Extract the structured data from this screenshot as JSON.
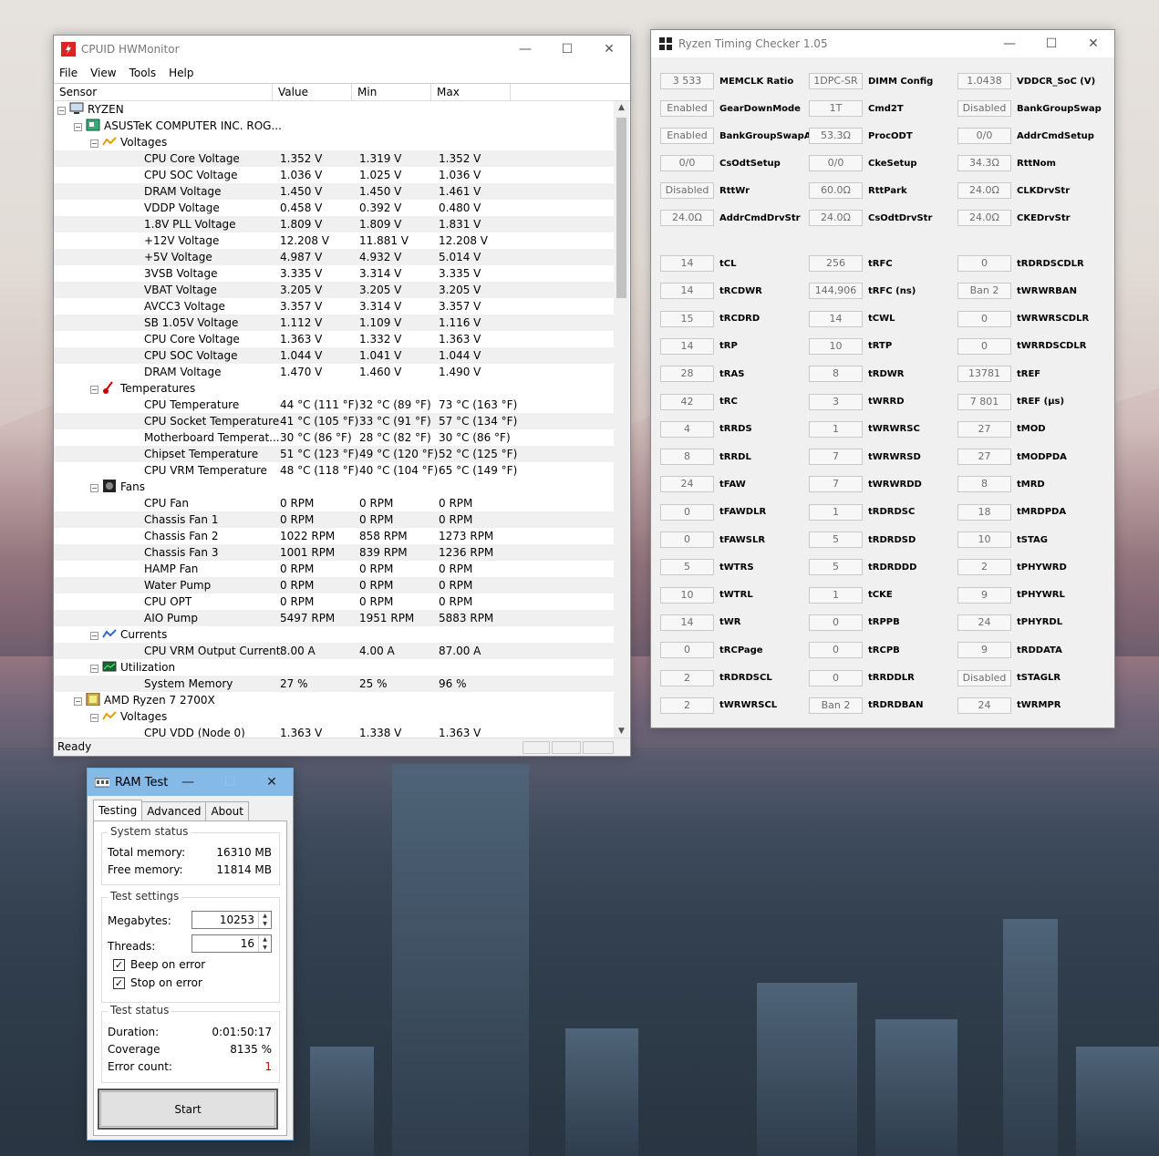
{
  "hwmonitor": {
    "title": "CPUID HWMonitor",
    "menu": [
      "File",
      "View",
      "Tools",
      "Help"
    ],
    "columns": [
      "Sensor",
      "Value",
      "Min",
      "Max"
    ],
    "status": "Ready",
    "rows": [
      {
        "level": 0,
        "type": "node",
        "icon": "computer-icon",
        "name": "RYZEN"
      },
      {
        "level": 1,
        "type": "node",
        "icon": "motherboard-icon",
        "name": "ASUSTeK COMPUTER INC. ROG..."
      },
      {
        "level": 2,
        "type": "node",
        "icon": "voltage-icon",
        "name": "Voltages"
      },
      {
        "level": 3,
        "name": "CPU Core Voltage",
        "value": "1.352 V",
        "min": "1.319 V",
        "max": "1.352 V"
      },
      {
        "level": 3,
        "name": "CPU SOC Voltage",
        "value": "1.036 V",
        "min": "1.025 V",
        "max": "1.036 V"
      },
      {
        "level": 3,
        "name": "DRAM Voltage",
        "value": "1.450 V",
        "min": "1.450 V",
        "max": "1.461 V"
      },
      {
        "level": 3,
        "name": "VDDP Voltage",
        "value": "0.458 V",
        "min": "0.392 V",
        "max": "0.480 V"
      },
      {
        "level": 3,
        "name": "1.8V PLL Voltage",
        "value": "1.809 V",
        "min": "1.809 V",
        "max": "1.831 V"
      },
      {
        "level": 3,
        "name": "+12V Voltage",
        "value": "12.208 V",
        "min": "11.881 V",
        "max": "12.208 V"
      },
      {
        "level": 3,
        "name": "+5V Voltage",
        "value": "4.987 V",
        "min": "4.932 V",
        "max": "5.014 V"
      },
      {
        "level": 3,
        "name": "3VSB Voltage",
        "value": "3.335 V",
        "min": "3.314 V",
        "max": "3.335 V"
      },
      {
        "level": 3,
        "name": "VBAT Voltage",
        "value": "3.205 V",
        "min": "3.205 V",
        "max": "3.205 V"
      },
      {
        "level": 3,
        "name": "AVCC3 Voltage",
        "value": "3.357 V",
        "min": "3.314 V",
        "max": "3.357 V"
      },
      {
        "level": 3,
        "name": "SB 1.05V Voltage",
        "value": "1.112 V",
        "min": "1.109 V",
        "max": "1.116 V"
      },
      {
        "level": 3,
        "name": "CPU Core Voltage",
        "value": "1.363 V",
        "min": "1.332 V",
        "max": "1.363 V"
      },
      {
        "level": 3,
        "name": "CPU SOC Voltage",
        "value": "1.044 V",
        "min": "1.041 V",
        "max": "1.044 V"
      },
      {
        "level": 3,
        "name": "DRAM Voltage",
        "value": "1.470 V",
        "min": "1.460 V",
        "max": "1.490 V"
      },
      {
        "level": 2,
        "type": "node",
        "icon": "thermometer-icon",
        "name": "Temperatures"
      },
      {
        "level": 3,
        "name": "CPU Temperature",
        "value": "44 °C  (111 °F)",
        "min": "32 °C  (89 °F)",
        "max": "73 °C  (163 °F)"
      },
      {
        "level": 3,
        "name": "CPU Socket Temperature",
        "value": "41 °C  (105 °F)",
        "min": "33 °C  (91 °F)",
        "max": "57 °C  (134 °F)"
      },
      {
        "level": 3,
        "name": "Motherboard Temperat...",
        "value": "30 °C  (86 °F)",
        "min": "28 °C  (82 °F)",
        "max": "30 °C  (86 °F)"
      },
      {
        "level": 3,
        "name": "Chipset Temperature",
        "value": "51 °C  (123 °F)",
        "min": "49 °C  (120 °F)",
        "max": "52 °C  (125 °F)"
      },
      {
        "level": 3,
        "name": "CPU VRM Temperature",
        "value": "48 °C  (118 °F)",
        "min": "40 °C  (104 °F)",
        "max": "65 °C  (149 °F)"
      },
      {
        "level": 2,
        "type": "node",
        "icon": "fan-icon",
        "name": "Fans"
      },
      {
        "level": 3,
        "name": "CPU Fan",
        "value": "0 RPM",
        "min": "0 RPM",
        "max": "0 RPM"
      },
      {
        "level": 3,
        "name": "Chassis Fan 1",
        "value": "0 RPM",
        "min": "0 RPM",
        "max": "0 RPM"
      },
      {
        "level": 3,
        "name": "Chassis Fan 2",
        "value": "1022 RPM",
        "min": "858 RPM",
        "max": "1273 RPM"
      },
      {
        "level": 3,
        "name": "Chassis Fan 3",
        "value": "1001 RPM",
        "min": "839 RPM",
        "max": "1236 RPM"
      },
      {
        "level": 3,
        "name": "HAMP Fan",
        "value": "0 RPM",
        "min": "0 RPM",
        "max": "0 RPM"
      },
      {
        "level": 3,
        "name": "Water Pump",
        "value": "0 RPM",
        "min": "0 RPM",
        "max": "0 RPM"
      },
      {
        "level": 3,
        "name": "CPU OPT",
        "value": "0 RPM",
        "min": "0 RPM",
        "max": "0 RPM"
      },
      {
        "level": 3,
        "name": "AIO Pump",
        "value": "5497 RPM",
        "min": "1951 RPM",
        "max": "5883 RPM"
      },
      {
        "level": 2,
        "type": "node",
        "icon": "current-icon",
        "name": "Currents"
      },
      {
        "level": 3,
        "name": "CPU VRM Output Current",
        "value": "8.00 A",
        "min": "4.00 A",
        "max": "87.00 A"
      },
      {
        "level": 2,
        "type": "node",
        "icon": "utilization-icon",
        "name": "Utilization"
      },
      {
        "level": 3,
        "name": "System Memory",
        "value": "27 %",
        "min": "25 %",
        "max": "96 %"
      },
      {
        "level": 1,
        "type": "node",
        "icon": "cpu-chip-icon",
        "name": "AMD Ryzen 7 2700X"
      },
      {
        "level": 2,
        "type": "node",
        "icon": "voltage-icon",
        "name": "Voltages"
      },
      {
        "level": 3,
        "name": "CPU VDD (Node 0)",
        "value": "1.363 V",
        "min": "1.338 V",
        "max": "1.363 V"
      }
    ]
  },
  "rtc": {
    "title": "Ryzen Timing Checker 1.05",
    "top_items": [
      {
        "value": "3 533",
        "label": "MEMCLK Ratio"
      },
      {
        "value": "1DPC-SR",
        "label": "DIMM Config"
      },
      {
        "value": "1.0438",
        "label": "VDDCR_SoC (V)"
      },
      {
        "value": "Enabled",
        "label": "GearDownMode"
      },
      {
        "value": "1T",
        "label": "Cmd2T"
      },
      {
        "value": "Disabled",
        "label": "BankGroupSwap"
      },
      {
        "value": "Enabled",
        "label": "BankGroupSwapAlt"
      },
      {
        "value": "53.3Ω",
        "label": "ProcODT"
      },
      {
        "value": "0/0",
        "label": "AddrCmdSetup"
      },
      {
        "value": "0/0",
        "label": "CsOdtSetup"
      },
      {
        "value": "0/0",
        "label": "CkeSetup"
      },
      {
        "value": "34.3Ω",
        "label": "RttNom"
      },
      {
        "value": "Disabled",
        "label": "RttWr"
      },
      {
        "value": "60.0Ω",
        "label": "RttPark"
      },
      {
        "value": "24.0Ω",
        "label": "CLKDrvStr"
      },
      {
        "value": "24.0Ω",
        "label": "AddrCmdDrvStr"
      },
      {
        "value": "24.0Ω",
        "label": "CsOdtDrvStr"
      },
      {
        "value": "24.0Ω",
        "label": "CKEDrvStr"
      }
    ],
    "timing_items": [
      {
        "value": "14",
        "label": "tCL"
      },
      {
        "value": "256",
        "label": "tRFC"
      },
      {
        "value": "0",
        "label": "tRDRDSCDLR"
      },
      {
        "value": "14",
        "label": "tRCDWR"
      },
      {
        "value": "144,906",
        "label": "tRFC (ns)"
      },
      {
        "value": "Ban 2",
        "label": "tWRWRBAN"
      },
      {
        "value": "15",
        "label": "tRCDRD"
      },
      {
        "value": "14",
        "label": "tCWL"
      },
      {
        "value": "0",
        "label": "tWRWRSCDLR"
      },
      {
        "value": "14",
        "label": "tRP"
      },
      {
        "value": "10",
        "label": "tRTP"
      },
      {
        "value": "0",
        "label": "tWRRDSCDLR"
      },
      {
        "value": "28",
        "label": "tRAS"
      },
      {
        "value": "8",
        "label": "tRDWR"
      },
      {
        "value": "13781",
        "label": "tREF"
      },
      {
        "value": "42",
        "label": "tRC"
      },
      {
        "value": "3",
        "label": "tWRRD"
      },
      {
        "value": "7 801",
        "label": "tREF (µs)"
      },
      {
        "value": "4",
        "label": "tRRDS"
      },
      {
        "value": "1",
        "label": "tWRWRSC"
      },
      {
        "value": "27",
        "label": "tMOD"
      },
      {
        "value": "8",
        "label": "tRRDL"
      },
      {
        "value": "7",
        "label": "tWRWRSD"
      },
      {
        "value": "27",
        "label": "tMODPDA"
      },
      {
        "value": "24",
        "label": "tFAW"
      },
      {
        "value": "7",
        "label": "tWRWRDD"
      },
      {
        "value": "8",
        "label": "tMRD"
      },
      {
        "value": "0",
        "label": "tFAWDLR"
      },
      {
        "value": "1",
        "label": "tRDRDSC"
      },
      {
        "value": "18",
        "label": "tMRDPDA"
      },
      {
        "value": "0",
        "label": "tFAWSLR"
      },
      {
        "value": "5",
        "label": "tRDRDSD"
      },
      {
        "value": "10",
        "label": "tSTAG"
      },
      {
        "value": "5",
        "label": "tWTRS"
      },
      {
        "value": "5",
        "label": "tRDRDDD"
      },
      {
        "value": "2",
        "label": "tPHYWRD"
      },
      {
        "value": "10",
        "label": "tWTRL"
      },
      {
        "value": "1",
        "label": "tCKE"
      },
      {
        "value": "9",
        "label": "tPHYWRL"
      },
      {
        "value": "14",
        "label": "tWR"
      },
      {
        "value": "0",
        "label": "tRPPB"
      },
      {
        "value": "24",
        "label": "tPHYRDL"
      },
      {
        "value": "0",
        "label": "tRCPage"
      },
      {
        "value": "0",
        "label": "tRCPB"
      },
      {
        "value": "9",
        "label": "tRDDATA"
      },
      {
        "value": "2",
        "label": "tRDRDSCL"
      },
      {
        "value": "0",
        "label": "tRRDDLR"
      },
      {
        "value": "Disabled",
        "label": "tSTAGLR"
      },
      {
        "value": "2",
        "label": "tWRWRSCL"
      },
      {
        "value": "Ban 2",
        "label": "tRDRDBAN"
      },
      {
        "value": "24",
        "label": "tWRMPR"
      }
    ]
  },
  "ramtest": {
    "title": "RAM Test",
    "tabs": [
      "Testing",
      "Advanced",
      "About"
    ],
    "system_status": {
      "title": "System status",
      "total_label": "Total memory:",
      "total_value": "16310 MB",
      "free_label": "Free memory:",
      "free_value": "11814 MB"
    },
    "test_settings": {
      "title": "Test settings",
      "mb_label": "Megabytes:",
      "mb_value": "10253",
      "threads_label": "Threads:",
      "threads_value": "16",
      "beep_label": "Beep on error",
      "stop_label": "Stop on error"
    },
    "test_status": {
      "title": "Test status",
      "duration_label": "Duration:",
      "duration_value": "0:01:50:17",
      "coverage_label": "Coverage",
      "coverage_value": "8135 %",
      "errors_label": "Error count:",
      "errors_value": "1"
    },
    "start_label": "Start"
  }
}
